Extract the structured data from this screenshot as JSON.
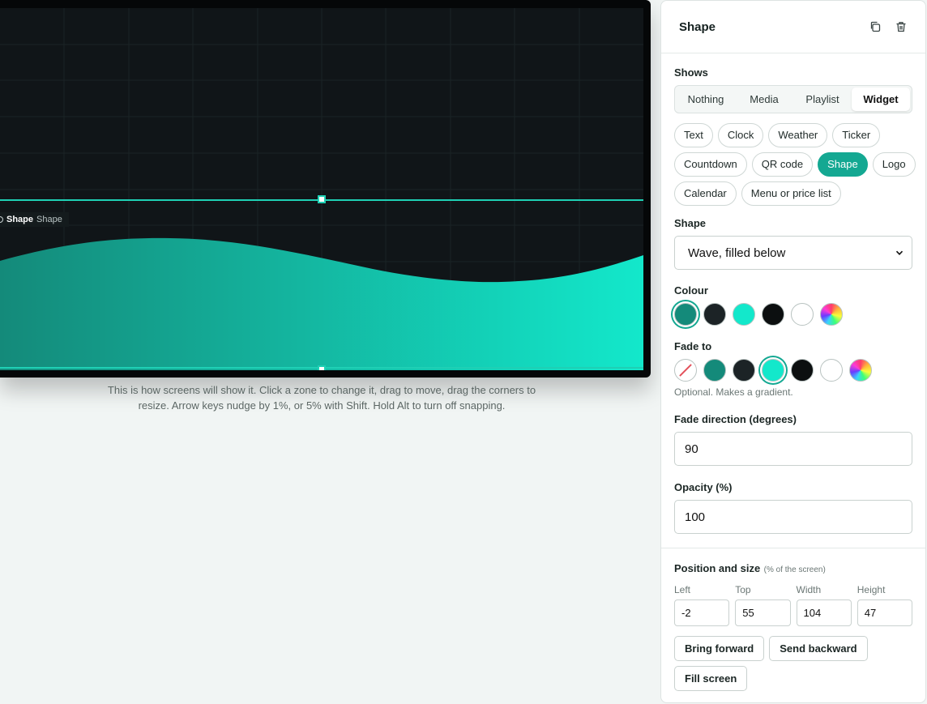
{
  "preview": {
    "zone_name": "Shape",
    "zone_type": "Shape",
    "caption": "This is how screens will show it. Click a zone to change it, drag to move, drag the corners to resize. Arrow keys nudge by 1%, or 5% with Shift. Hold Alt to turn off snapping."
  },
  "panel": {
    "title": "Shape",
    "icons": [
      "duplicate-icon",
      "trash-icon"
    ],
    "shows": {
      "label": "Shows",
      "tabs": [
        "Nothing",
        "Media",
        "Playlist",
        "Widget"
      ],
      "active": "Widget"
    },
    "widgets": {
      "items": [
        "Text",
        "Clock",
        "Weather",
        "Ticker",
        "Countdown",
        "QR code",
        "Shape",
        "Logo",
        "Calendar",
        "Menu or price list"
      ],
      "active": "Shape"
    },
    "shape": {
      "label": "Shape",
      "value": "Wave, filled below"
    },
    "colour": {
      "label": "Colour",
      "swatches": [
        "#148a7a",
        "#1c2326",
        "#13e8cb",
        "#0c0f10",
        "#ffffff",
        "custom-rainbow"
      ],
      "selected": "#148a7a"
    },
    "fade_to": {
      "label": "Fade to",
      "swatches": [
        "none",
        "#148a7a",
        "#1c2326",
        "#13e8cb",
        "#0c0f10",
        "#ffffff",
        "custom-rainbow"
      ],
      "selected": "#13e8cb",
      "hint": "Optional. Makes a gradient."
    },
    "fade_direction": {
      "label": "Fade direction (degrees)",
      "value": "90"
    },
    "opacity": {
      "label": "Opacity (%)",
      "value": "100"
    },
    "position": {
      "label": "Position and size",
      "note": "(% of the screen)",
      "fields": [
        {
          "label": "Left",
          "value": "-2"
        },
        {
          "label": "Top",
          "value": "55"
        },
        {
          "label": "Width",
          "value": "104"
        },
        {
          "label": "Height",
          "value": "47"
        }
      ]
    },
    "buttons": {
      "bring_forward": "Bring forward",
      "send_backward": "Send backward",
      "fill_screen": "Fill screen"
    }
  },
  "colors": {
    "accent": "#14a892",
    "zone_outline": "#1fd0b5",
    "wave_start": "#148a7a",
    "wave_end": "#13e8cb"
  }
}
